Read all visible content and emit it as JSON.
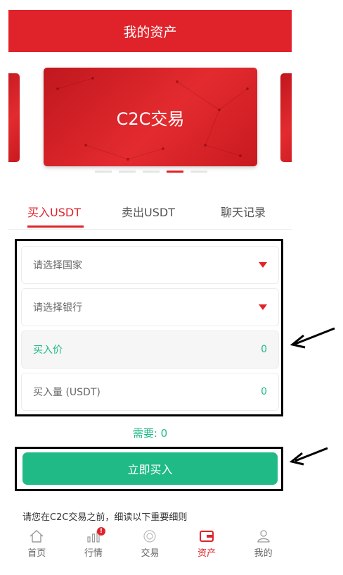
{
  "header": {
    "title": "我的资产"
  },
  "carousel": {
    "main_label": "C2C交易",
    "dots": 5,
    "active_dot": 3
  },
  "tabs": [
    {
      "label": "买入USDT",
      "active": true
    },
    {
      "label": "卖出USDT",
      "active": false
    },
    {
      "label": "聊天记录",
      "active": false
    }
  ],
  "form": {
    "country": {
      "placeholder": "请选择国家"
    },
    "bank": {
      "placeholder": "请选择银行"
    },
    "price": {
      "label": "买入价",
      "value": "0"
    },
    "amount": {
      "label": "买入量 (USDT)",
      "value": "0"
    }
  },
  "need_text": "需要: 0",
  "buy_button": "立即买入",
  "notice": "请您在C2C交易之前，细读以下重要细则",
  "bottom_nav": [
    {
      "label": "首页",
      "icon": "home-icon"
    },
    {
      "label": "行情",
      "icon": "market-icon",
      "badge": "!"
    },
    {
      "label": "交易",
      "icon": "trade-icon"
    },
    {
      "label": "资产",
      "icon": "wallet-icon",
      "active": true
    },
    {
      "label": "我的",
      "icon": "user-icon"
    }
  ],
  "colors": {
    "brand_red": "#e0232b",
    "accent_green": "#1fba85"
  }
}
